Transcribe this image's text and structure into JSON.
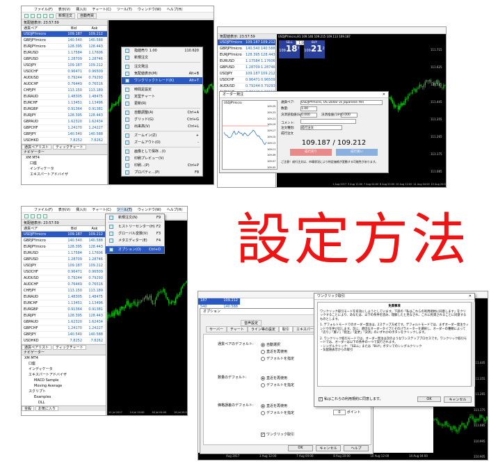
{
  "heading": "設定方法",
  "menu": {
    "file": "ファイル(F)",
    "view": "表示(V)",
    "insert": "挿入(I)",
    "chart": "チャート(C)",
    "tools": "ツール(T)",
    "window": "ウィンドウ(W)",
    "help": "ヘルプ(H)"
  },
  "toolbar": {
    "new_order": "新規注文",
    "auto_trade": "自動売買"
  },
  "market_watch": {
    "title_1": "気配値表示: 23:57:59",
    "title_2": "気配値表示: 23:57:59",
    "col_pair": "通貨ペア",
    "col_bid": "Bid",
    "col_ask": "Ask",
    "rows": [
      {
        "pair": "USDJPYmicro",
        "bid": "109.187",
        "ask": "109.212"
      },
      {
        "pair": "GBPJPYmicro",
        "bid": "140.540",
        "ask": "140.588"
      },
      {
        "pair": "EURJPYmicro",
        "bid": "128.395",
        "ask": "128.443"
      },
      {
        "pair": "EURUSD",
        "bid": "1.17584",
        "ask": "1.17606"
      },
      {
        "pair": "GBPUSD",
        "bid": "1.28709",
        "ask": "1.28746"
      },
      {
        "pair": "USDJPY",
        "bid": "109.187",
        "ask": "109.212"
      },
      {
        "pair": "USDCHF",
        "bid": "0.96471",
        "ask": "0.96509"
      },
      {
        "pair": "AUDUSD",
        "bid": "0.79244",
        "ask": "0.79293"
      },
      {
        "pair": "AUDCHF",
        "bid": "0.76449",
        "ask": "0.76516"
      },
      {
        "pair": "CHFJPY",
        "bid": "113.150",
        "ask": "113.189"
      },
      {
        "pair": "EURAUD",
        "bid": "1.48305",
        "ask": "1.48475"
      },
      {
        "pair": "EURCHF",
        "bid": "1.13451",
        "ask": "1.13496"
      },
      {
        "pair": "EURGBP",
        "bid": "0.91364",
        "ask": "0.91381"
      },
      {
        "pair": "EURJPY",
        "bid": "128.395",
        "ask": "128.443"
      },
      {
        "pair": "GBPAUD",
        "bid": "1.62320",
        "ask": "1.62434"
      },
      {
        "pair": "GBPCHF",
        "bid": "1.24170",
        "ask": "1.24227"
      },
      {
        "pair": "GBPJPY",
        "bid": "140.540",
        "ask": "140.588"
      },
      {
        "pair": "USDHKD",
        "bid": "7.8252",
        "ask": "7.8262"
      }
    ],
    "tabs": [
      "通貨ペアリスト",
      "ティックチャート"
    ]
  },
  "navigator": {
    "title": "ナビゲーター",
    "items": [
      "XM MT4",
      "口座",
      "インディケータ",
      "エキスパートアドバイザ",
      "MACD Sample",
      "Moving Average",
      "スクリプト",
      "Examples",
      "DLL"
    ],
    "tabs": [
      "全般",
      "お気に入り"
    ]
  },
  "context_menu": {
    "items": [
      {
        "label": "指値売り 1.00",
        "kb": "110.620"
      },
      {
        "label": "新規注文",
        "kb": ""
      },
      {
        "label": "注文発注",
        "kb": ""
      },
      {
        "label": "気配値表示(M)",
        "kb": "Alt+B"
      },
      {
        "label": "ワンクリックトレード(K)",
        "kb": "Alt+T"
      },
      {
        "label": "時間足設定",
        "kb": ""
      },
      {
        "label": "定型チャート",
        "kb": ""
      },
      {
        "label": "更新(R)",
        "kb": ""
      },
      {
        "label": "自動調整(A)",
        "kb": "Ctrl+A"
      },
      {
        "label": "グリッド(G)",
        "kb": "Ctrl+G"
      },
      {
        "label": "出来高(V)",
        "kb": "Ctrl+L"
      },
      {
        "label": "ズームイン(Z)",
        "kb": "+"
      },
      {
        "label": "ズームアウト(O)",
        "kb": "-"
      },
      {
        "label": "画像として保存...(I)",
        "kb": ""
      },
      {
        "label": "印刷プレビュー(V)",
        "kb": ""
      },
      {
        "label": "印刷...(P)",
        "kb": "Ctrl+P"
      },
      {
        "label": "プロパティ...(P)",
        "kb": "F8"
      }
    ]
  },
  "tools_menu": {
    "items": [
      {
        "label": "新規注文(N)",
        "kb": "F9"
      },
      {
        "label": "ヒストリーセンター(H)",
        "kb": "F2"
      },
      {
        "label": "グローバル変数(V)",
        "kb": "F3"
      },
      {
        "label": "メタエディター(E)",
        "kb": "F4"
      },
      {
        "label": "オプション(O)",
        "kb": "Ctrl+O"
      }
    ]
  },
  "chart_window": {
    "title": "USDJPYmicro,H1  109.146 109.215 109.113 109.187",
    "oneclick_sell": "109",
    "oneclick_sell_big": "18",
    "oneclick_sell_sup": "7",
    "oneclick_buy": "109",
    "oneclick_buy_big": "21",
    "oneclick_buy_sup": "2",
    "sell_label": "SELL",
    "buy_label": "BUY",
    "lot": "1.00",
    "dates": [
      "1 Aug 2017",
      "3 Aug 12:00",
      "7 Aug 04:00",
      "8 Aug 20:00",
      "10 Aug 12:00",
      "14 Aug 04:00",
      "15 Aug 20:00",
      "17 Aug 12:00",
      "21 Aug 04:00"
    ],
    "prices": [
      "111.715",
      "111.625",
      "111.535",
      "111.445",
      "111.355",
      "111.265",
      "111.175",
      "111.085"
    ],
    "bottom_dates": [
      "11 Jul 2017",
      "14 Jul 20:00",
      "18 Jul 04:00",
      "19 Jul 20:00"
    ]
  },
  "order_dialog": {
    "title": "オーダー発注",
    "symbol_label": "通貨ペア:",
    "symbol_value": "USDJPYmicro, US Dollar vs Japanese Yen",
    "volume_label": "数量:",
    "volume_value": "1.00",
    "sl_label": "決済逆指値(S/L):",
    "sl_value": "0.000",
    "tp_label": "決済指値(T/P):",
    "tp_value": "0.000",
    "comment_label": "コメント:",
    "type_label": "注文種別:",
    "type_value": "成行注文",
    "exec_label": "成行注文",
    "price": "109.187 / 109.212",
    "sell_btn": "成行売り",
    "buy_btn": "成行買い",
    "note": "ご注意！成行注文は、市場状況により約定価格が変動する可能性があります。",
    "chart_symbol": "USDJPYmicro",
    "y_ticks": [
      "109.25",
      "109.23",
      "109.21",
      "109.19",
      "109.17",
      "109.15",
      "109.13",
      "109.11",
      "109.09",
      "109.07",
      "109.05"
    ]
  },
  "options_dialog": {
    "title": "オプション",
    "tabs": [
      "音声設定",
      "サーバー",
      "チャート",
      "ライン等の設定",
      "取引",
      "エキスパートアドバイザ"
    ],
    "row1_label": "通貨ペアのデフォルト:",
    "row1_opts": [
      "自動選択",
      "直近を再使用",
      "デフォルトを指定"
    ],
    "row2_label": "数量のデフォルト:",
    "row2_opts": [
      "直近を再使用",
      "デフォルトを指定"
    ],
    "row3_label": "価格誤差のデフォルト:",
    "row3_opts": [
      "直近を再使用",
      "デフォルトを指定"
    ],
    "slip_value": "0",
    "slip_unit": "ポイント",
    "oneclick_chk": "ワンクリック取引",
    "buttons": [
      "OK",
      "キャンセル",
      "ヘルプ"
    ],
    "mw_values": [
      "187",
      "540",
      "109.212",
      "140.588"
    ]
  },
  "oneclick_dialog": {
    "title": "ワンクリック取引",
    "heading": "免責事項",
    "p1": "ワンクリック取引モードを有効にしようとしています。下部の「私はこれらの利用規約に同意します」をクリックすることにより、あなたは、以下の条件を読み、理解したと見なされ、これに拘束されることに同意するものとします。",
    "p2": "1. デフォルトモードでのオーダー発注は、2ステップ方式です。デフォルトモードでは、まずオーダー発注ウィンドウを呼び出します。次に、適切なオーダータイプとそのパラメーターを選択し、オーダーの種類によって「売り」「買い」「発注」「変更」「決済」のいずれかのボタンをクリックします。",
    "p3": "2. ワンクリック取引モードでは、オーダー発注は次のようなワンステッププロセスです。ワンクリック取引モードでは、オーダーは以下の条件の一つで実行されます。",
    "p4": "・シングルクリック: 「SELL」または「BUY」ボタンでのシングルクリック",
    "p5": "・気配値表示からの取引",
    "agree": "私はこれらの利用規約に同意します。",
    "ok": "OK",
    "cancel": "キャンセル",
    "right_prices": [
      "111.445",
      "111.355",
      "111.265",
      "111.175",
      "111.085",
      "110.995",
      "110.905"
    ],
    "bottom_dates": [
      "Aug 2017",
      "3 Aug 12:00",
      "7 Aug 04:00",
      "8 Aug 20:00",
      "10 Aug 12:00",
      "14 Aug 04:00"
    ]
  },
  "colors": {
    "heading": "#ee1414",
    "chart_bg": "#000000",
    "candle": "#00e000",
    "selection": "#2a59c4",
    "bid_text": "#1560bd"
  }
}
